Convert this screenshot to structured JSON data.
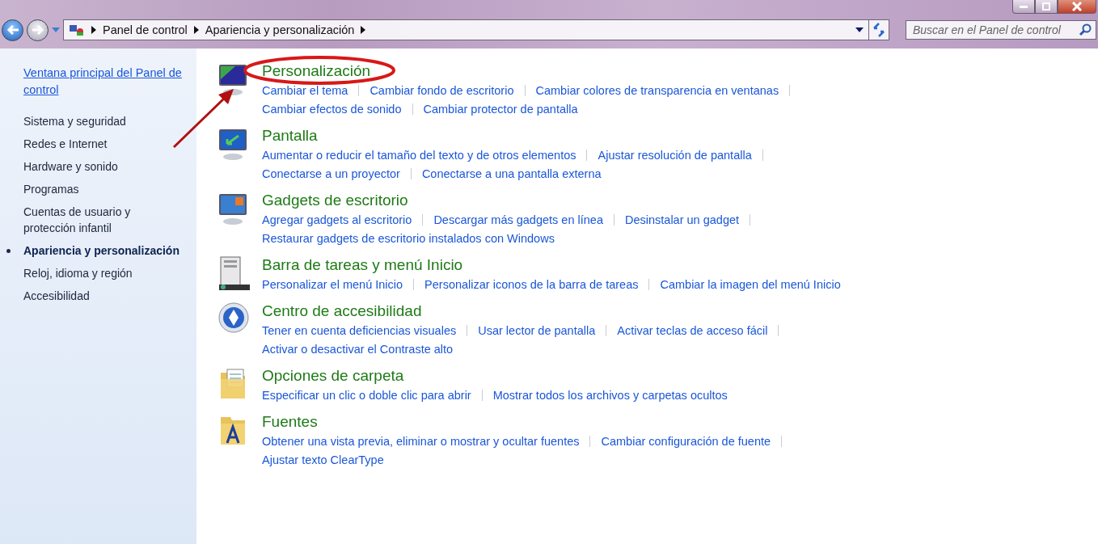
{
  "breadcrumb": [
    "Panel de control",
    "Apariencia y personalización"
  ],
  "search": {
    "placeholder": "Buscar en el Panel de control"
  },
  "sidebar": {
    "home_link": "Ventana principal del Panel de control",
    "items": [
      {
        "label": "Sistema y seguridad",
        "selected": false
      },
      {
        "label": "Redes e Internet",
        "selected": false
      },
      {
        "label": "Hardware y sonido",
        "selected": false
      },
      {
        "label": "Programas",
        "selected": false
      },
      {
        "label": "Cuentas de usuario y protección infantil",
        "selected": false
      },
      {
        "label": "Apariencia y personalización",
        "selected": true
      },
      {
        "label": "Reloj, idioma y región",
        "selected": false
      },
      {
        "label": "Accesibilidad",
        "selected": false
      }
    ]
  },
  "categories": [
    {
      "kind": "personalization",
      "title": "Personalización",
      "highlighted": true,
      "lines": [
        [
          "Cambiar el tema",
          "Cambiar fondo de escritorio",
          "Cambiar colores de transparencia en ventanas"
        ],
        [
          "Cambiar efectos de sonido",
          "Cambiar protector de pantalla"
        ]
      ]
    },
    {
      "kind": "display",
      "title": "Pantalla",
      "highlighted": false,
      "lines": [
        [
          "Aumentar o reducir el tamaño del texto y de otros elementos",
          "Ajustar resolución de pantalla"
        ],
        [
          "Conectarse a un proyector",
          "Conectarse a una pantalla externa"
        ]
      ]
    },
    {
      "kind": "gadgets",
      "title": "Gadgets de escritorio",
      "highlighted": false,
      "lines": [
        [
          "Agregar gadgets al escritorio",
          "Descargar más gadgets en línea",
          "Desinstalar un gadget"
        ],
        [
          "Restaurar gadgets de escritorio instalados con Windows"
        ]
      ]
    },
    {
      "kind": "taskbar",
      "title": "Barra de tareas y menú Inicio",
      "highlighted": false,
      "lines": [
        [
          "Personalizar el menú Inicio",
          "Personalizar iconos de la barra de tareas",
          "Cambiar la imagen del menú Inicio"
        ]
      ]
    },
    {
      "kind": "accessibility",
      "title": "Centro de accesibilidad",
      "highlighted": false,
      "lines": [
        [
          "Tener en cuenta deficiencias visuales",
          "Usar lector de pantalla",
          "Activar teclas de acceso fácil"
        ],
        [
          "Activar o desactivar el Contraste alto"
        ]
      ]
    },
    {
      "kind": "folder",
      "title": "Opciones de carpeta",
      "highlighted": false,
      "lines": [
        [
          "Especificar un clic o doble clic para abrir",
          "Mostrar todos los archivos y carpetas ocultos"
        ]
      ]
    },
    {
      "kind": "fonts",
      "title": "Fuentes",
      "highlighted": false,
      "lines": [
        [
          "Obtener una vista previa, eliminar o mostrar y ocultar fuentes",
          "Cambiar configuración de fuente"
        ],
        [
          "Ajustar texto ClearType"
        ]
      ]
    }
  ]
}
